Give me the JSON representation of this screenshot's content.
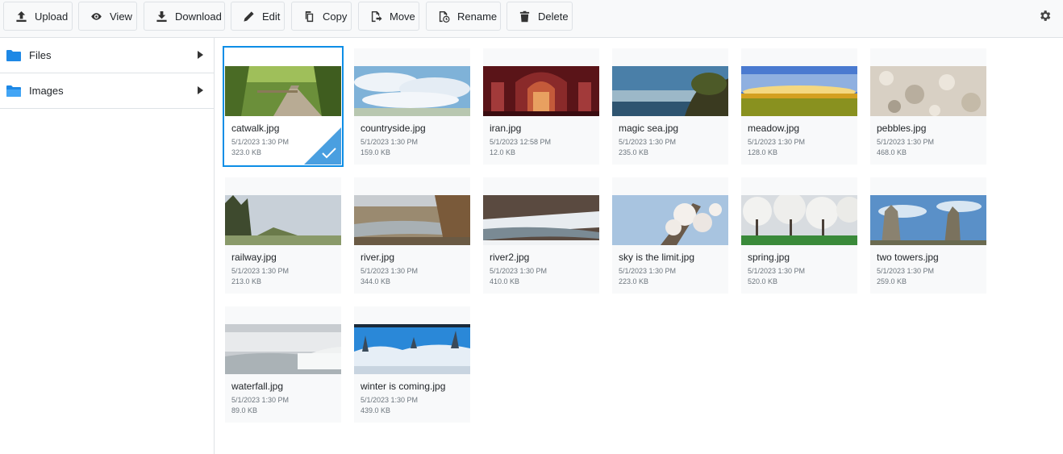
{
  "toolbar": {
    "buttons": [
      {
        "label": "Upload",
        "icon": "upload-icon"
      },
      {
        "label": "View",
        "icon": "eye-icon"
      },
      {
        "label": "Download",
        "icon": "download-icon"
      },
      {
        "label": "Edit",
        "icon": "pencil-icon"
      },
      {
        "label": "Copy",
        "icon": "copy-icon"
      },
      {
        "label": "Move",
        "icon": "move-icon"
      },
      {
        "label": "Rename",
        "icon": "rename-icon"
      },
      {
        "label": "Delete",
        "icon": "trash-icon"
      }
    ],
    "settings_icon": "gear-icon"
  },
  "sidebar": {
    "items": [
      {
        "label": "Files",
        "icon": "folder-icon"
      },
      {
        "label": "Images",
        "icon": "folder-icon"
      }
    ],
    "folder_color": "#1e88e5"
  },
  "files": [
    {
      "name": "catwalk.jpg",
      "date": "5/1/2023 1:30 PM",
      "size": "323.0 KB",
      "selected": true
    },
    {
      "name": "countryside.jpg",
      "date": "5/1/2023 1:30 PM",
      "size": "159.0 KB"
    },
    {
      "name": "iran.jpg",
      "date": "5/1/2023 12:58 PM",
      "size": "12.0 KB"
    },
    {
      "name": "magic sea.jpg",
      "date": "5/1/2023 1:30 PM",
      "size": "235.0 KB"
    },
    {
      "name": "meadow.jpg",
      "date": "5/1/2023 1:30 PM",
      "size": "128.0 KB"
    },
    {
      "name": "pebbles.jpg",
      "date": "5/1/2023 1:30 PM",
      "size": "468.0 KB"
    },
    {
      "name": "railway.jpg",
      "date": "5/1/2023 1:30 PM",
      "size": "213.0 KB"
    },
    {
      "name": "river.jpg",
      "date": "5/1/2023 1:30 PM",
      "size": "344.0 KB"
    },
    {
      "name": "river2.jpg",
      "date": "5/1/2023 1:30 PM",
      "size": "410.0 KB"
    },
    {
      "name": "sky is the limit.jpg",
      "date": "5/1/2023 1:30 PM",
      "size": "223.0 KB"
    },
    {
      "name": "spring.jpg",
      "date": "5/1/2023 1:30 PM",
      "size": "520.0 KB"
    },
    {
      "name": "two towers.jpg",
      "date": "5/1/2023 1:30 PM",
      "size": "259.0 KB"
    },
    {
      "name": "waterfall.jpg",
      "date": "5/1/2023 1:30 PM",
      "size": "89.0 KB"
    },
    {
      "name": "winter is coming.jpg",
      "date": "5/1/2023 1:30 PM",
      "size": "439.0 KB"
    }
  ],
  "colors": {
    "accent": "#0d8ee6",
    "selection_corner": "#4a9fe0",
    "muted_text": "#6c757d"
  }
}
